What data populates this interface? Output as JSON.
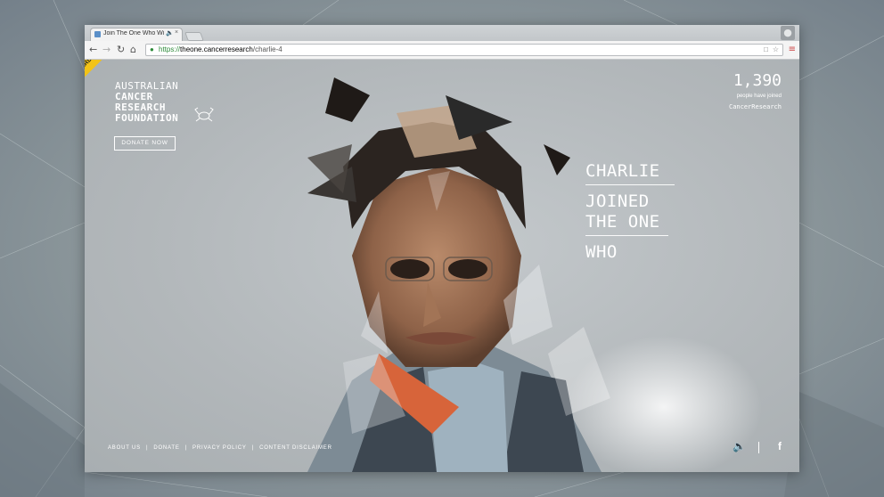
{
  "browser": {
    "tab_title": "Join The One Who Will B",
    "url_scheme": "https://",
    "url_host": "theone.cancerresearch",
    "url_path": "/charlie-4"
  },
  "header": {
    "badge": "AWARD SITE OF THE DAY",
    "logo_lines": [
      "AUSTRALIAN",
      "CANCER",
      "RESEARCH",
      "FOUNDATION"
    ],
    "donate_label": "DONATE NOW"
  },
  "counter": {
    "value": "1,390",
    "caption": "people have joined",
    "hashtag": "CancerResearch"
  },
  "story": {
    "name": "CHARLIE",
    "line2": "JOINED",
    "line3": "THE ONE",
    "line4": "WHO"
  },
  "footer": {
    "links": [
      "ABOUT US",
      "DONATE",
      "PRIVACY POLICY",
      "CONTENT DISCLAIMER"
    ],
    "separator": "|"
  },
  "colors": {
    "badge": "#f2c317",
    "scarf": "#d7643a",
    "secure": "#2e8b3a"
  }
}
